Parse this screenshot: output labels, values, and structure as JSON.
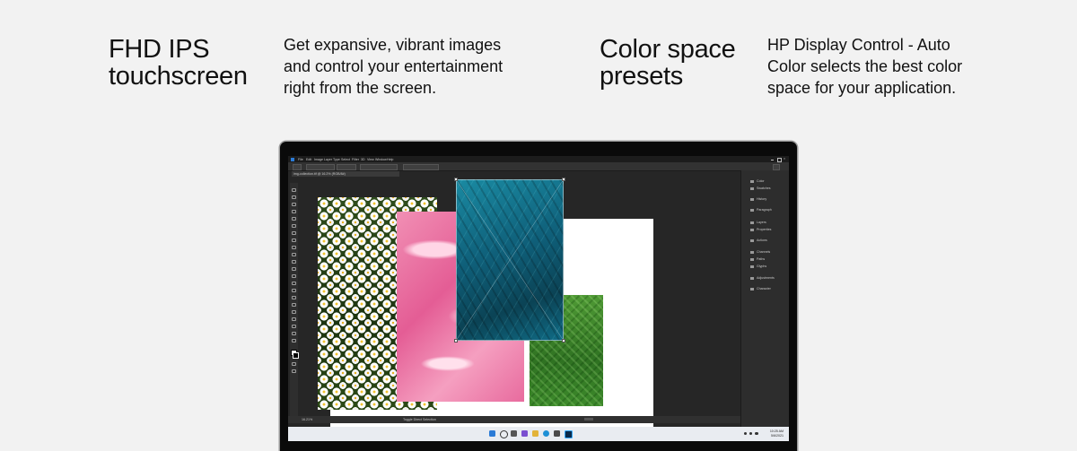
{
  "features": [
    {
      "title_line1": "FHD IPS",
      "title_line2": "touchscreen",
      "desc_line1": "Get expansive, vibrant images",
      "desc_line2": "and control your entertainment",
      "desc_line3": "right from the screen."
    },
    {
      "title_line1": "Color space",
      "title_line2": "presets",
      "desc_line1": "HP Display Control - Auto",
      "desc_line2": "Color selects the best color",
      "desc_line3": "space for your application."
    }
  ],
  "app": {
    "menu": [
      "File",
      "Edit",
      "Image",
      "Layer",
      "Type",
      "Select",
      "Filter",
      "3D",
      "View",
      "Window",
      "Help"
    ],
    "doc_tab": "img-collection.tif @ 16.2% (RGB/8#)",
    "status_zoom": "16.21%",
    "status_hint": "Toggle Direct Selection",
    "panels": [
      "Color",
      "Swatches",
      "History",
      "Paragraph",
      "Layers",
      "Properties",
      "Actions",
      "Channels",
      "Paths",
      "Glyphs",
      "Adjustments",
      "Character"
    ]
  },
  "taskbar": {
    "time": "10:25 AM",
    "date": "5/6/2021"
  },
  "colors": {
    "background": "#f2f2f2",
    "text": "#111111",
    "app_bg": "#262626",
    "taskbar": "#e9ecf1"
  }
}
